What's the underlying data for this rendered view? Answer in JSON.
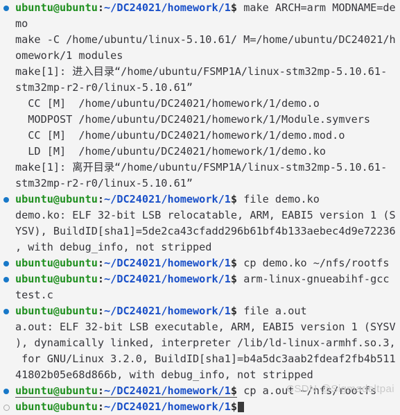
{
  "terminal": {
    "prompt": {
      "user": "ubuntu@ubuntu",
      "colon": ":",
      "path": "~/DC24021/homework/1",
      "dollar": "$"
    },
    "colors": {
      "background": "#f4f4f4",
      "user": "#1f8f1f",
      "path": "#1a50c8",
      "text": "#36363b",
      "bullet_active": "#1878c8",
      "bullet_idle": "#a9a9a9",
      "watermark": "#c9c9c9"
    },
    "lines": [
      {
        "kind": "prompt",
        "bullet": "filled",
        "command": " make ARCH=arm MODNAME=de"
      },
      {
        "kind": "output",
        "text": "mo"
      },
      {
        "kind": "output",
        "text": "make -C /home/ubuntu/linux-5.10.61/ M=/home/ubuntu/DC24021/h"
      },
      {
        "kind": "output",
        "text": "omework/1 modules"
      },
      {
        "kind": "output",
        "text": "make[1]: 进入目录“/home/ubuntu/FSMP1A/linux-stm32mp-5.10.61-"
      },
      {
        "kind": "output",
        "text": "stm32mp-r2-r0/linux-5.10.61”"
      },
      {
        "kind": "output",
        "text": "  CC [M]  /home/ubuntu/DC24021/homework/1/demo.o"
      },
      {
        "kind": "output",
        "text": "  MODPOST /home/ubuntu/DC24021/homework/1/Module.symvers"
      },
      {
        "kind": "output",
        "text": "  CC [M]  /home/ubuntu/DC24021/homework/1/demo.mod.o"
      },
      {
        "kind": "output",
        "text": "  LD [M]  /home/ubuntu/DC24021/homework/1/demo.ko"
      },
      {
        "kind": "output",
        "text": "make[1]: 离开目录“/home/ubuntu/FSMP1A/linux-stm32mp-5.10.61-"
      },
      {
        "kind": "output",
        "text": "stm32mp-r2-r0/linux-5.10.61”"
      },
      {
        "kind": "prompt",
        "bullet": "filled",
        "command": " file demo.ko"
      },
      {
        "kind": "output",
        "text": "demo.ko: ELF 32-bit LSB relocatable, ARM, EABI5 version 1 (S"
      },
      {
        "kind": "output",
        "text": "YSV), BuildID[sha1]=5de2ca43cfadd296b61bf4b133aebec4d9e72236"
      },
      {
        "kind": "output",
        "text": ", with debug_info, not stripped"
      },
      {
        "kind": "prompt",
        "bullet": "filled",
        "command": " cp demo.ko ~/nfs/rootfs"
      },
      {
        "kind": "prompt",
        "bullet": "filled",
        "command": " arm-linux-gnueabihf-gcc"
      },
      {
        "kind": "output",
        "text": "test.c"
      },
      {
        "kind": "prompt",
        "bullet": "filled",
        "command": " file a.out"
      },
      {
        "kind": "output",
        "text": "a.out: ELF 32-bit LSB executable, ARM, EABI5 version 1 (SYSV"
      },
      {
        "kind": "output",
        "text": "), dynamically linked, interpreter /lib/ld-linux-armhf.so.3,"
      },
      {
        "kind": "output",
        "text": " for GNU/Linux 3.2.0, BuildID[sha1]=b4a5dc3aab2fdeaf2fb4b511"
      },
      {
        "kind": "output",
        "text": "41802b05e68d866b, with debug_info, not stripped"
      },
      {
        "kind": "prompt",
        "bullet": "filled",
        "underlined": true,
        "command": " cp a.out ~/nfs/rootfs"
      },
      {
        "kind": "prompt",
        "bullet": "hollow",
        "command": "",
        "cursor": true
      }
    ],
    "watermark": "CSDN @Sigmadeltpai"
  }
}
